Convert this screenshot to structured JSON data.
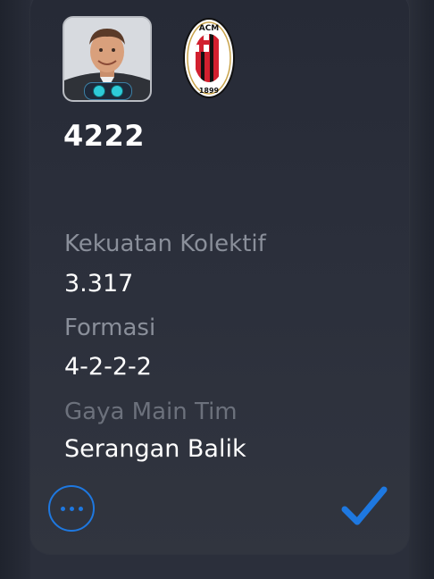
{
  "team": {
    "formation_code": "4222",
    "manager_avatar": "manager-avatar",
    "club_badge": {
      "text_top": "ACM",
      "year": "1899",
      "colors": {
        "red": "#d2202f",
        "black": "#111111",
        "gold": "#c9a34a"
      }
    }
  },
  "stats": {
    "team_strength_label": "Kekuatan Kolektif",
    "team_strength_value": "3.317",
    "formation_label": "Formasi",
    "formation_value": "4-2-2-2",
    "play_style_label": "Gaya Main Tim",
    "play_style_value": "Serangan Balik"
  },
  "actions": {
    "more_icon": "ellipsis-circle-icon",
    "confirm_icon": "checkmark-icon",
    "accent": "#1e78e0"
  }
}
